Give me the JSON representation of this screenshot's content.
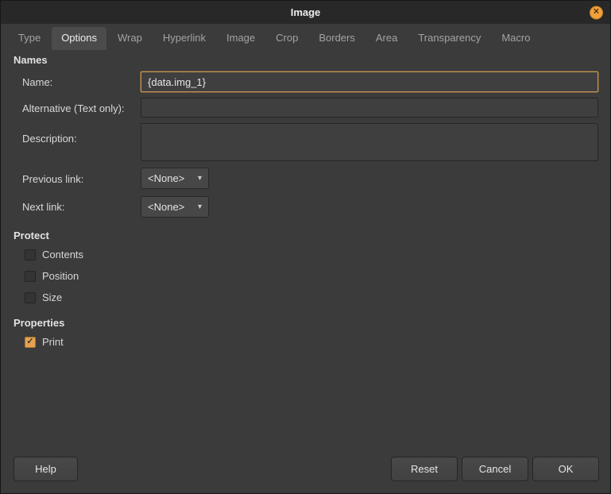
{
  "window": {
    "title": "Image"
  },
  "tabs": [
    {
      "label": "Type",
      "active": false
    },
    {
      "label": "Options",
      "active": true
    },
    {
      "label": "Wrap",
      "active": false
    },
    {
      "label": "Hyperlink",
      "active": false
    },
    {
      "label": "Image",
      "active": false
    },
    {
      "label": "Crop",
      "active": false
    },
    {
      "label": "Borders",
      "active": false
    },
    {
      "label": "Area",
      "active": false
    },
    {
      "label": "Transparency",
      "active": false
    },
    {
      "label": "Macro",
      "active": false
    }
  ],
  "names_section": {
    "heading": "Names",
    "name": {
      "label": "Name:",
      "value": "{data.img_1}",
      "focused": true
    },
    "alternative": {
      "label": "Alternative (Text only):",
      "value": ""
    },
    "description": {
      "label": "Description:",
      "value": ""
    },
    "previous_link": {
      "label": "Previous link:",
      "value": "<None>"
    },
    "next_link": {
      "label": "Next link:",
      "value": "<None>"
    }
  },
  "protect_section": {
    "heading": "Protect",
    "items": [
      {
        "label": "Contents",
        "checked": false
      },
      {
        "label": "Position",
        "checked": false
      },
      {
        "label": "Size",
        "checked": false
      }
    ]
  },
  "properties_section": {
    "heading": "Properties",
    "items": [
      {
        "label": "Print",
        "checked": true
      }
    ]
  },
  "footer": {
    "help": "Help",
    "reset": "Reset",
    "cancel": "Cancel",
    "ok": "OK"
  },
  "icons": {
    "chevron_down": "▾",
    "check": "✓",
    "close": "✕"
  },
  "colors": {
    "titlebar_bg": "#282828",
    "dialog_bg": "#3b3b3b",
    "accent_orange": "#e5a24e",
    "focus_border": "#c8974f"
  }
}
